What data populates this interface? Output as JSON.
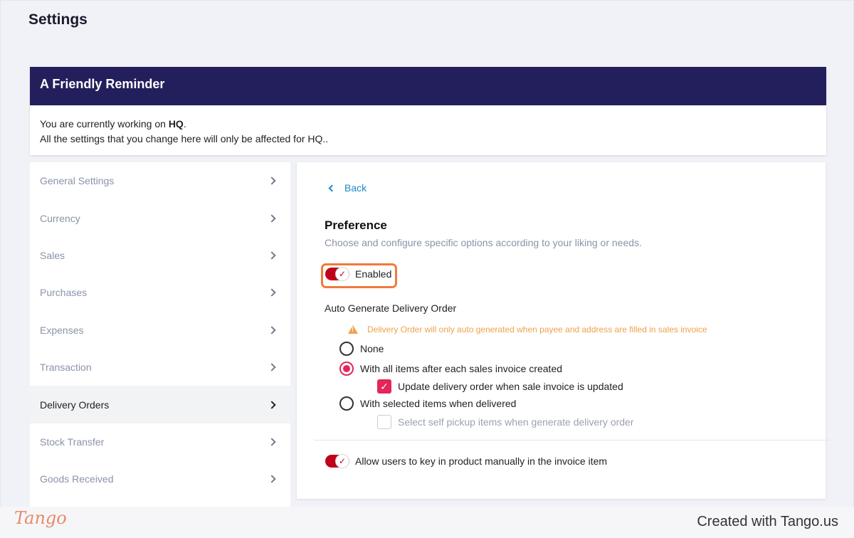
{
  "page": {
    "title": "Settings"
  },
  "reminder": {
    "title": "A Friendly Reminder",
    "line1_prefix": "You are currently working on ",
    "line1_branch": "HQ",
    "line1_suffix": ".",
    "line2": "All the settings that you change here will only be affected for HQ.."
  },
  "sidebar": {
    "items": [
      {
        "label": "General Settings"
      },
      {
        "label": "Currency"
      },
      {
        "label": "Sales"
      },
      {
        "label": "Purchases"
      },
      {
        "label": "Expenses"
      },
      {
        "label": "Transaction"
      },
      {
        "label": "Delivery Orders",
        "active": true
      },
      {
        "label": "Stock Transfer"
      },
      {
        "label": "Goods Received"
      }
    ]
  },
  "panel": {
    "back_label": "Back",
    "title": "Preference",
    "description": "Choose and configure specific options according to your liking or needs.",
    "enabled_label": "Enabled",
    "enabled_on": true,
    "auto_generate_label": "Auto Generate Delivery Order",
    "warning": "Delivery Order will only auto generated when payee and address are filled in sales invoice",
    "options": {
      "none": "None",
      "all_items": "With all items after each sales invoice created",
      "update_on_invoice": "Update delivery order when sale invoice is updated",
      "selected_items": "With selected items when delivered",
      "self_pickup": "Select self pickup items when generate delivery order"
    },
    "selected_option": "all_items",
    "manual_entry_label": "Allow users to key in product manually in the invoice item",
    "manual_entry_on": true
  },
  "footer": {
    "logo": "Tango",
    "created": "Created with Tango.us"
  },
  "colors": {
    "brand_dark": "#231f5c",
    "toggle_on": "#c0001a",
    "accent": "#e4265a",
    "link": "#1e88c7",
    "highlight": "#f07a3c",
    "warning": "#f0a04b"
  }
}
